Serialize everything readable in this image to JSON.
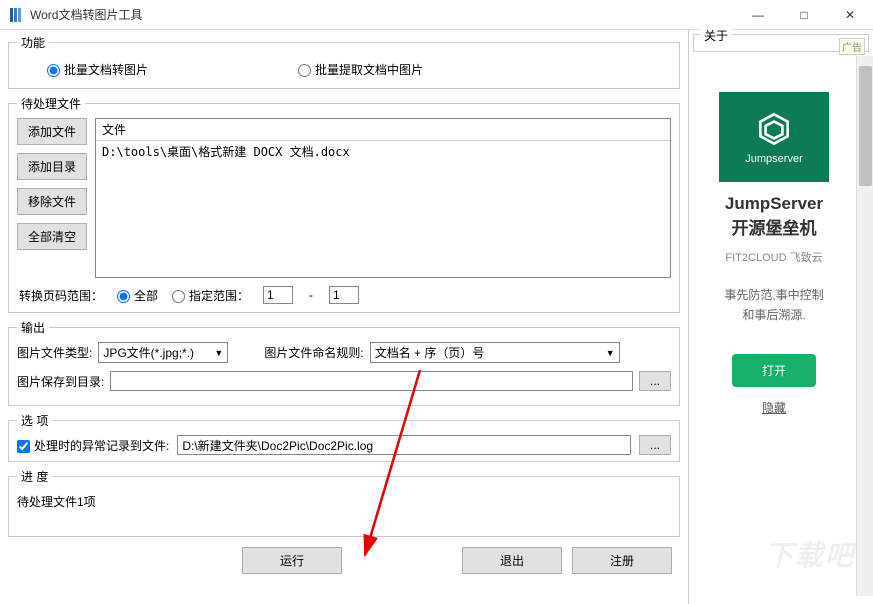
{
  "window": {
    "title": "Word文档转图片工具",
    "min_icon": "—",
    "max_icon": "□",
    "close_icon": "✕"
  },
  "func": {
    "legend": "功能",
    "opt1": "批量文档转图片",
    "opt2": "批量提取文档中图片"
  },
  "pending": {
    "legend": "待处理文件",
    "add_file": "添加文件",
    "add_dir": "添加目录",
    "remove_file": "移除文件",
    "clear_all": "全部清空",
    "list_header": "文件",
    "file0": "D:\\tools\\桌面\\格式新建 DOCX 文档.docx",
    "range_label": "转换页码范围：",
    "range_all": "全部",
    "range_spec": "指定范围：",
    "range_from": "1",
    "range_to": "1"
  },
  "output": {
    "legend": "输出",
    "type_label": "图片文件类型:",
    "type_value": "JPG文件(*.jpg;*.)",
    "naming_label": "图片文件命名规则:",
    "naming_value": "文档名 + 序（页）号",
    "save_label": "图片保存到目录:",
    "save_value": "",
    "browse": "..."
  },
  "options": {
    "legend": "选  项",
    "log_check": "处理时的异常记录到文件:",
    "log_path": "D:\\新建文件夹\\Doc2Pic\\Doc2Pic.log",
    "browse": "..."
  },
  "progress": {
    "legend": "进  度",
    "text": "待处理文件1项"
  },
  "buttons": {
    "run": "运行",
    "exit": "退出",
    "register": "注册"
  },
  "about": {
    "legend": "关于",
    "ad_tag": "广告",
    "jumpserver": "Jumpserver",
    "title1": "JumpServer",
    "title2": "开源堡垒机",
    "sub": "FIT2CLOUD 飞致云",
    "desc1": "事先防范,事中控制",
    "desc2": "和事后溯源.",
    "open": "打开",
    "hide": "隐藏",
    "watermark": "下载吧"
  }
}
